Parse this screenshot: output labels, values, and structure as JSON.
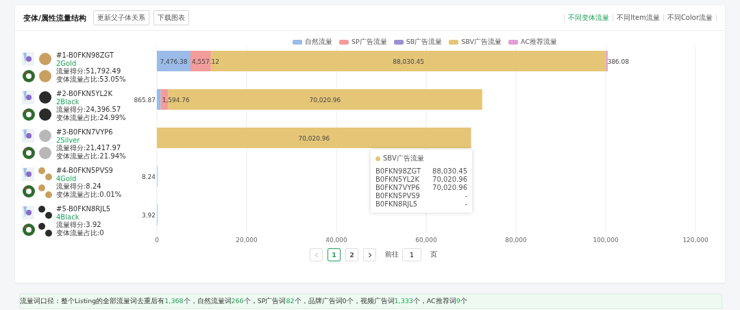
{
  "header": {
    "title": "变体/属性流量结构",
    "buttons": [
      "更新父子体关系",
      "下载图表"
    ],
    "tabs": [
      {
        "label": "不同变体流量",
        "selected": true
      },
      {
        "label": "不同Item流量",
        "selected": false
      },
      {
        "label": "不同Color流量",
        "selected": false
      }
    ]
  },
  "products": [
    {
      "variant": "2Gold",
      "score": "流量得分:51,792.49",
      "share": "变体流量占比:53.05%"
    },
    {
      "variant": "2Black",
      "score": "流量得分:24,396.57",
      "share": "变体流量占比:24.99%"
    },
    {
      "variant": "2Silver",
      "score": "流量得分:21,417.97",
      "share": "变体流量占比:21.94%"
    },
    {
      "variant": "4Gold",
      "score": "流量得分:8.24",
      "share": "变体流量占比:0.01%"
    },
    {
      "variant": "4Black",
      "score": "流量得分:3.92",
      "share": "变体流量占比:0"
    }
  ],
  "chart_data": {
    "type": "bar",
    "orientation": "horizontal",
    "stacked": true,
    "grid": true,
    "categories": [
      "#1-B0FKN98ZGT",
      "#2-B0FKN5YL2K",
      "#3-B0FKN7VYP6",
      "#4-B0FKN5PVS9",
      "#5-B0FKN8RJL5"
    ],
    "xlim": [
      0,
      120000
    ],
    "xticks": [
      {
        "value": 0,
        "label": "0"
      },
      {
        "value": 20000,
        "label": "20,000"
      },
      {
        "value": 40000,
        "label": "40,000"
      },
      {
        "value": 60000,
        "label": "60,000"
      },
      {
        "value": 80000,
        "label": "80,000"
      },
      {
        "value": 100000,
        "label": "100,000"
      },
      {
        "value": 120000,
        "label": "120,000"
      }
    ],
    "series": [
      {
        "name": "自然流量",
        "color": "#9bbbe8",
        "values": [
          7476.38,
          865.87,
          null,
          8.24,
          3.92
        ],
        "value_labels": [
          "7,476.38",
          "865.87",
          null,
          "8.24",
          "3.92"
        ]
      },
      {
        "name": "SP广告流量",
        "color": "#f29c9c",
        "values": [
          4557.12,
          1594.76,
          null,
          null,
          null
        ],
        "value_labels": [
          "4,557.12",
          "1,594.76",
          null,
          null,
          null
        ]
      },
      {
        "name": "SB广告流量",
        "color": "#9c8fd4",
        "values": [
          null,
          null,
          null,
          null,
          null
        ]
      },
      {
        "name": "SBV广告流量",
        "color": "#e5c677",
        "values": [
          88030.45,
          70020.96,
          70020.96,
          null,
          null
        ],
        "value_labels": [
          "88,030.45",
          "70,020.96",
          "70,020.96",
          null,
          null
        ]
      },
      {
        "name": "AC推荐流量",
        "color": "#e09fd6",
        "values": [
          386.08,
          null,
          null,
          null,
          null
        ],
        "value_labels": [
          "386.08",
          null,
          null,
          null,
          null
        ]
      }
    ]
  },
  "tooltip": {
    "series": "SBV广告流量",
    "color": "#e5c677",
    "rows": [
      {
        "label": "B0FKN98ZGT",
        "value": "88,030.45"
      },
      {
        "label": "B0FKN5YL2K",
        "value": "70,020.96"
      },
      {
        "label": "B0FKN7VYP6",
        "value": "70,020.96"
      },
      {
        "label": "B0FKN5PVS9",
        "value": "-"
      },
      {
        "label": "B0FKN8RJL5",
        "value": "-"
      }
    ]
  },
  "pagination": {
    "pages": [
      {
        "label": "1",
        "selected": true
      },
      {
        "label": "2",
        "selected": false
      }
    ],
    "prev_disabled": true,
    "next_disabled": false,
    "goto_label": "前往",
    "goto_value": "1",
    "goto_suffix": "页"
  },
  "footer": {
    "segments": [
      {
        "text": "流量词口径：整个Listing的全部流量词去重后有",
        "kind": "plain"
      },
      {
        "text": "1,368",
        "kind": "number"
      },
      {
        "text": "个，自然流量词",
        "kind": "plain"
      },
      {
        "text": "266",
        "kind": "number"
      },
      {
        "text": "个，SP广告词",
        "kind": "plain"
      },
      {
        "text": "82",
        "kind": "number"
      },
      {
        "text": "个，品牌广告词0个，视频广告词",
        "kind": "plain"
      },
      {
        "text": "1,333",
        "kind": "number"
      },
      {
        "text": "个，AC推荐词",
        "kind": "plain"
      },
      {
        "text": "9",
        "kind": "number"
      },
      {
        "text": "个",
        "kind": "plain"
      }
    ]
  }
}
